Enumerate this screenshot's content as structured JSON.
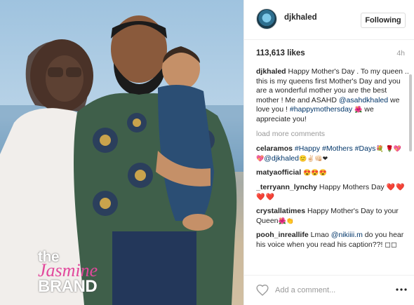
{
  "post": {
    "username": "djkhaled",
    "follow_label": "Following",
    "likes": "113,613 likes",
    "time": "4h",
    "caption_user": "djkhaled",
    "caption_text": "Happy Mother's Day . To my queen .. this is my queens first Mother's Day and you are a wonderful mother you are the best mother ! Me and ASAHD",
    "caption_mention": "@asahdkhaled",
    "caption_text2": "we love you !",
    "caption_hashtag": "#happymothersday",
    "caption_emoji": "🌺",
    "caption_text3": "we appreciate you!",
    "load_more": "load more comments"
  },
  "comments": [
    {
      "user": "celaramos",
      "tags": "#Happy #Mothers #Days",
      "emoji_a": "💐",
      "emoji_b": "🌹💖💖",
      "mention": "@djkhaled",
      "emoji_c": "🙂✌🏻👊🏻❤"
    },
    {
      "user": "matyaofficial",
      "emoji": "😍😍😍"
    },
    {
      "user": "_terryann_lynchy",
      "text": "Happy Mothers Day",
      "emoji": "❤️❤️❤️❤️"
    },
    {
      "user": "crystallatimes",
      "text": "Happy Mother's Day to your Queen",
      "emoji": "🌺👏"
    },
    {
      "user": "pooh_inreallife",
      "text_a": "Lmao",
      "mention": "@nikiiii.m",
      "text_b": "do you hear his voice when you read his caption??!",
      "emoji": "◻◻"
    }
  ],
  "footer": {
    "comment_placeholder": "Add a comment...",
    "heart_icon": "heart-outline-icon",
    "more_icon": "more-options-icon"
  },
  "watermark": {
    "line1": "the",
    "line2": "Jasmine",
    "line3": "BRAND"
  },
  "colors": {
    "link": "#003569",
    "muted": "#999999",
    "border": "#efefef",
    "watermark_pink": "#e2489c"
  }
}
